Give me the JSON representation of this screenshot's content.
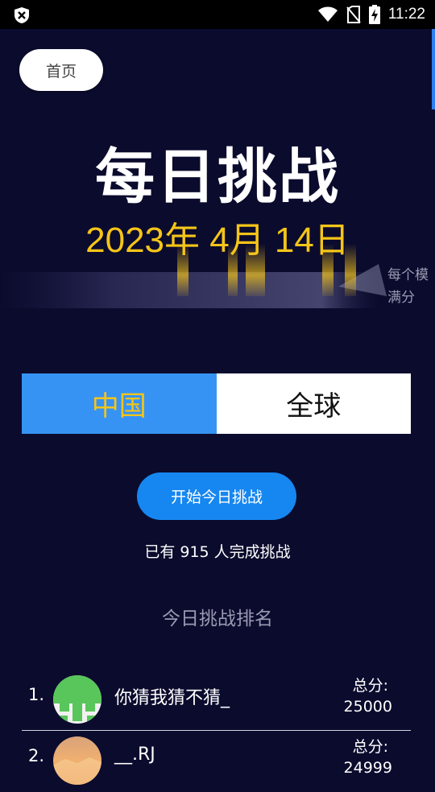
{
  "status_bar": {
    "time": "11:22",
    "icons": [
      "shield-icon",
      "wifi-icon",
      "no-sim-icon",
      "battery-charging-icon"
    ]
  },
  "nav": {
    "home_label": "首页"
  },
  "header": {
    "title": "每日挑战",
    "date": "2023年 4月 14日"
  },
  "marquee_text": [
    "每个模",
    "满分"
  ],
  "tabs": [
    {
      "label": "中国",
      "active": true
    },
    {
      "label": "全球",
      "active": false
    }
  ],
  "start_button_label": "开始今日挑战",
  "completed_text": "已有 915 人完成挑战",
  "ranking": {
    "title": "今日挑战排名",
    "score_label": "总分:",
    "rows": [
      {
        "rank": "1.",
        "name": "你猜我猜不猜_",
        "score": "25000"
      },
      {
        "rank": "2.",
        "name": "__.RJ",
        "score": "24999"
      }
    ]
  },
  "colors": {
    "background": "#0b0b2e",
    "accent_blue": "#3793f3",
    "date_yellow": "#f5c518",
    "button_blue": "#1687f0"
  }
}
